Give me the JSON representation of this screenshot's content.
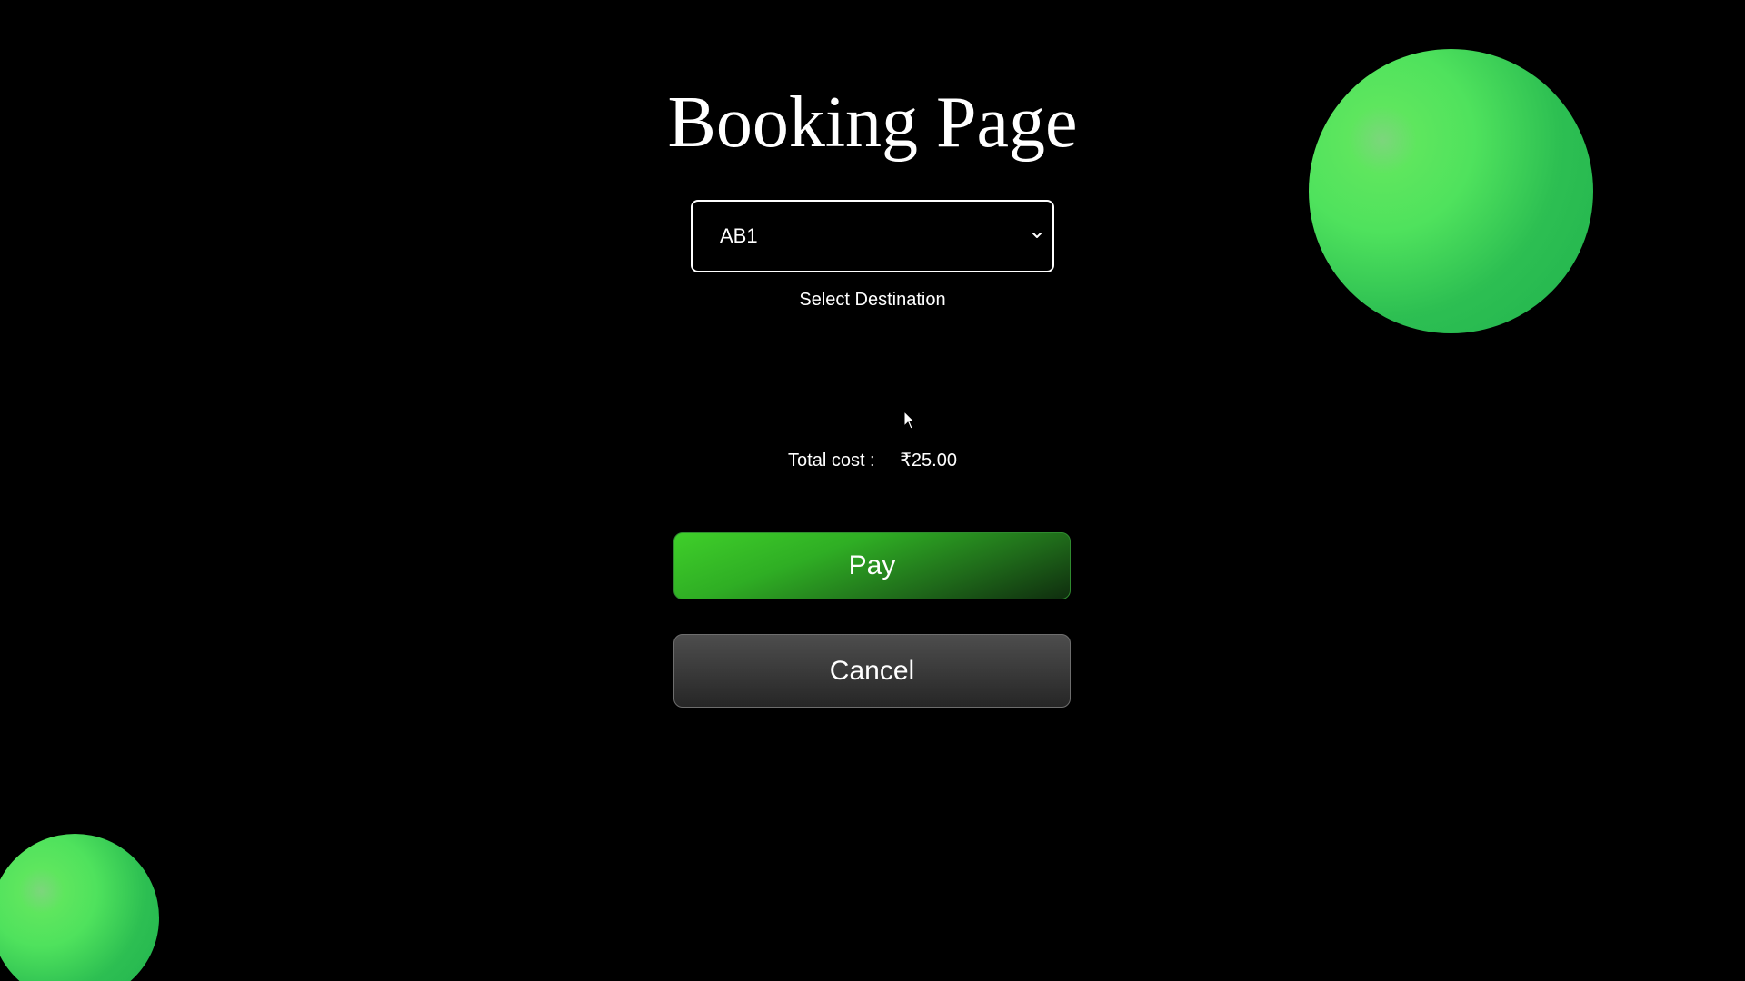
{
  "page": {
    "title": "Booking Page"
  },
  "destination_select": {
    "selected_value": "AB1",
    "label": "Select Destination"
  },
  "total": {
    "label": "Total cost :",
    "amount": "₹25.00"
  },
  "buttons": {
    "pay_label": "Pay",
    "cancel_label": "Cancel"
  },
  "colors": {
    "background": "#000000",
    "accent_green": "#4fe25d",
    "pay_button_start": "#3fcf2a",
    "cancel_button": "#3a3a3a",
    "text": "#ffffff"
  },
  "icons": {
    "select_chevron": "chevron-down-icon",
    "mouse_cursor": "cursor-icon"
  }
}
